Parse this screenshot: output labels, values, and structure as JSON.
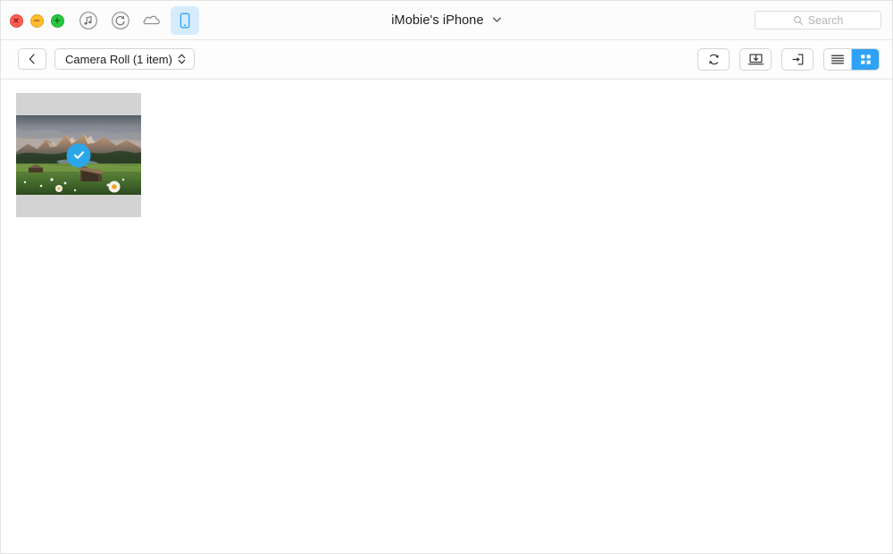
{
  "window": {
    "traffic_lights": [
      {
        "name": "close",
        "glyph": "×",
        "color": "#ff5f57"
      },
      {
        "name": "minimize",
        "glyph": "−",
        "color": "#ffbd2e"
      },
      {
        "name": "maximize",
        "glyph": "+",
        "color": "#28c840"
      }
    ],
    "title": "iMobie's iPhone",
    "title_chevron": "chevron-down-icon"
  },
  "nav": {
    "items": [
      {
        "icon": "music-note-circle-icon",
        "active": false
      },
      {
        "icon": "backup-restore-circle-icon",
        "active": false
      },
      {
        "icon": "cloud-icon",
        "active": false
      },
      {
        "icon": "iphone-device-icon",
        "active": true
      }
    ],
    "active_accent": "#2ea2f7",
    "active_background": "#d6ecfd"
  },
  "search": {
    "icon": "search-icon",
    "placeholder": "Search",
    "value": ""
  },
  "toolbar": {
    "back_icon": "chevron-left-icon",
    "breadcrumb_label": "Camera Roll (1 item)",
    "breadcrumb_chevron": "chevron-up-down-icon",
    "actions": [
      {
        "name": "refresh-button",
        "icon": "sync-refresh-icon"
      },
      {
        "name": "export-to-mac-button",
        "icon": "download-to-tray-icon"
      },
      {
        "name": "import-to-device-button",
        "icon": "import-arrow-into-box-icon"
      }
    ],
    "view_modes": [
      {
        "name": "list-view",
        "icon": "list-lines-icon",
        "selected": false
      },
      {
        "name": "grid-view",
        "icon": "grid-squares-icon",
        "selected": true
      }
    ],
    "selected_view": "grid-view",
    "accent": "#2ea2f7"
  },
  "content": {
    "item_count": 1,
    "items": [
      {
        "name": "photo-thumbnail",
        "selected": true,
        "selection_badge": "checkmark-circle-icon",
        "badge_color": "#2ba6e8",
        "description": "Mountain meadow landscape with wooden cabin and daisies"
      }
    ],
    "cell_background": "#d3d3d3"
  }
}
